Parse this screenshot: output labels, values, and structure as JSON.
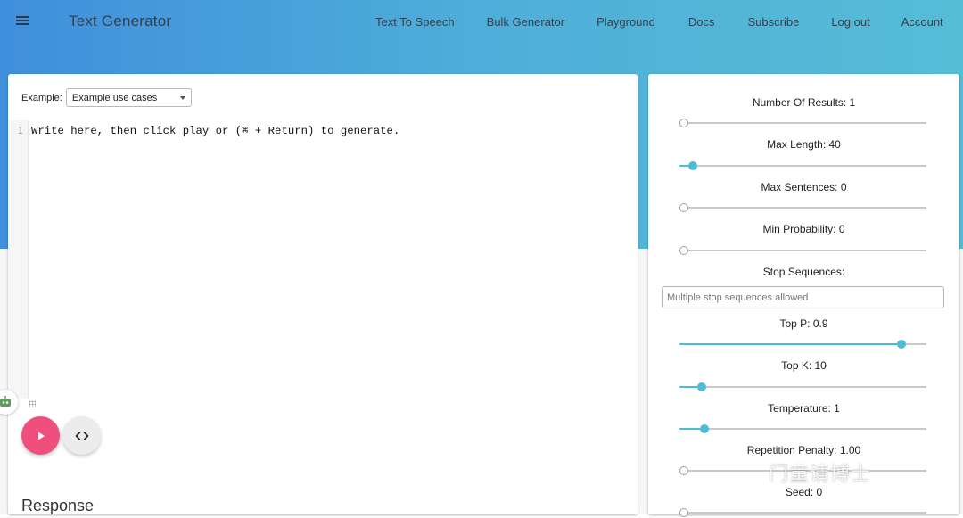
{
  "header": {
    "brand": "Text Generator",
    "nav": [
      {
        "label": "Text To Speech"
      },
      {
        "label": "Bulk Generator"
      },
      {
        "label": "Playground"
      },
      {
        "label": "Docs"
      },
      {
        "label": "Subscribe"
      },
      {
        "label": "Log out"
      },
      {
        "label": "Account"
      }
    ]
  },
  "editor": {
    "example_label": "Example:",
    "example_selected": "Example use cases",
    "line_number": "1",
    "code_text": "Write here, then click play or (⌘ + Return) to generate.",
    "response_title": "Response"
  },
  "params": {
    "num_results": {
      "label": "Number Of Results: 1",
      "fraction": 0.0
    },
    "max_length": {
      "label": "Max Length: 40",
      "fraction": 0.055
    },
    "max_sentences": {
      "label": "Max Sentences: 0",
      "fraction": 0.0
    },
    "min_probability": {
      "label": "Min Probability: 0",
      "fraction": 0.0
    },
    "stop_sequences": {
      "label": "Stop Sequences:",
      "placeholder": "Multiple stop sequences allowed"
    },
    "top_p": {
      "label": "Top P: 0.9",
      "fraction": 0.9
    },
    "top_k": {
      "label": "Top K: 10",
      "fraction": 0.09
    },
    "temperature": {
      "label": "Temperature: 1",
      "fraction": 0.1
    },
    "repetition_penalty": {
      "label": "Repetition Penalty: 1.00",
      "fraction": 0.0
    },
    "seed": {
      "label": "Seed: 0",
      "fraction": 0.0
    }
  },
  "watermark": "门童请博士",
  "colors": {
    "accent": "#4fbcd5",
    "play": "#ef4f7c"
  }
}
